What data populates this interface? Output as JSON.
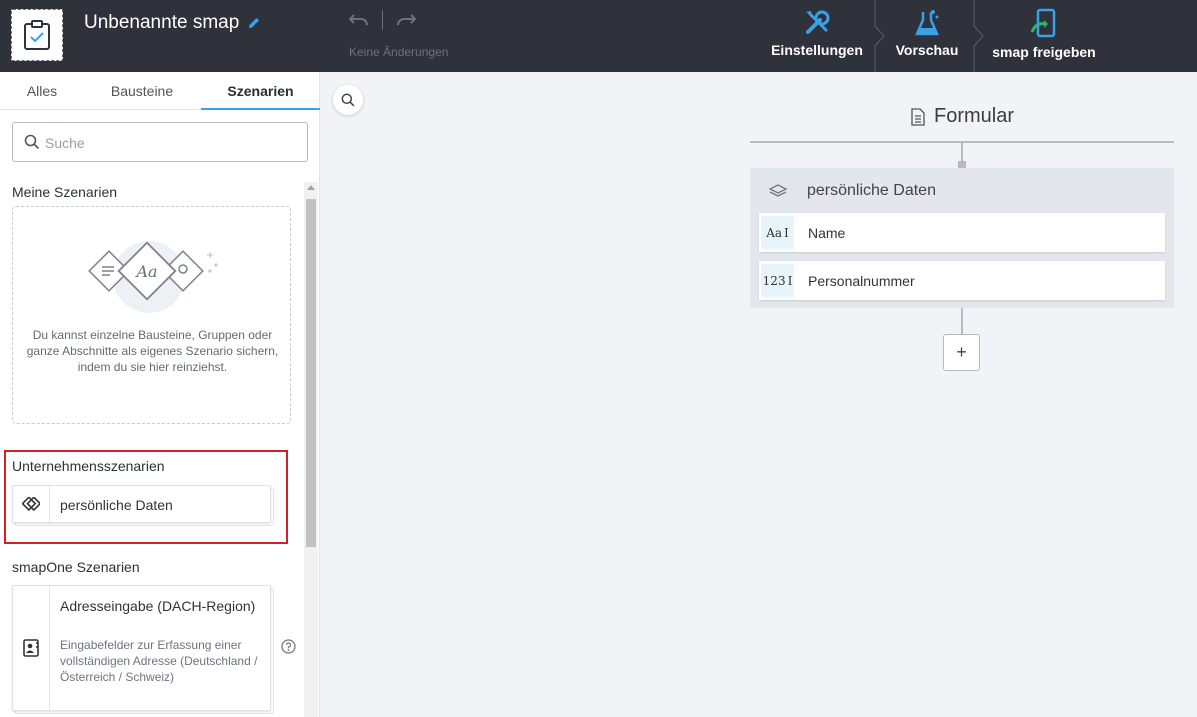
{
  "header": {
    "doc_title": "Unbenannte smap",
    "status": "Keine Änderungen",
    "actions": [
      {
        "label": "Einstellungen",
        "icon": "tools-icon"
      },
      {
        "label": "Vorschau",
        "icon": "flask-icon"
      },
      {
        "label": "smap freigeben",
        "icon": "phone-share-icon"
      }
    ]
  },
  "sidebar": {
    "tabs": [
      "Alles",
      "Bausteine",
      "Szenarien"
    ],
    "active_tab": "Szenarien",
    "search_placeholder": "Suche",
    "my_scenarios": {
      "label": "Meine Szenarien",
      "empty_text": "Du kannst einzelne Bausteine, Gruppen oder ganze Abschnitte als eigenes Szenario sichern, indem du sie hier reinziehst."
    },
    "company_scenarios": {
      "label": "Unternehmensszenarien",
      "items": [
        {
          "title": "persönliche Daten"
        }
      ]
    },
    "smapone_scenarios": {
      "label": "smapOne Szenarien",
      "items": [
        {
          "title": "Adresseingabe (DACH-Region)",
          "description": "Eingabefelder zur Erfassung einer vollständigen Adresse (Deutschland / Österreich / Schweiz)"
        }
      ]
    }
  },
  "canvas": {
    "form_title": "Formular",
    "group": {
      "title": "persönliche Daten",
      "fields": [
        {
          "label": "Name",
          "icon_text": "Aa"
        },
        {
          "label": "Personalnummer",
          "icon_text": "123"
        }
      ]
    },
    "add_label": "+"
  },
  "colors": {
    "topbar": "#2f323b",
    "accent_blue": "#3aa0e8",
    "highlight_red": "#d0212b"
  }
}
